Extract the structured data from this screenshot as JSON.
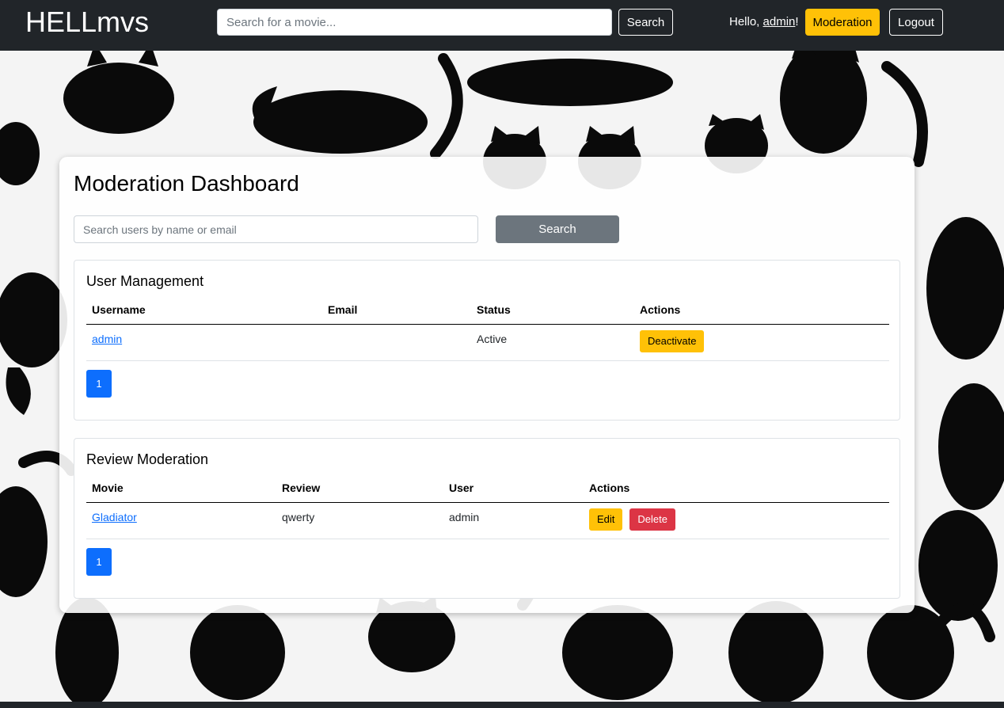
{
  "navbar": {
    "brand": "HELLmvs",
    "search_placeholder": "Search for a movie...",
    "search_label": "Search",
    "hello_prefix": "Hello, ",
    "username": "admin",
    "hello_suffix": "!",
    "moderation_label": "Moderation",
    "logout_label": "Logout"
  },
  "dashboard": {
    "title": "Moderation Dashboard",
    "search_placeholder": "Search users by name or email",
    "search_label": "Search"
  },
  "users": {
    "title": "User Management",
    "columns": [
      "Username",
      "Email",
      "Status",
      "Actions"
    ],
    "rows": [
      {
        "username": "admin",
        "email": "",
        "status": "Active",
        "action": "Deactivate"
      }
    ],
    "page": "1"
  },
  "reviews": {
    "title": "Review Moderation",
    "columns": [
      "Movie",
      "Review",
      "User",
      "Actions"
    ],
    "rows": [
      {
        "movie": "Gladiator",
        "review": "qwerty",
        "user": "admin",
        "edit": "Edit",
        "delete": "Delete"
      }
    ],
    "page": "1"
  },
  "colors": {
    "navbar": "#212529",
    "warning": "#ffc107",
    "danger": "#dc3545",
    "primary": "#0d6efd",
    "secondary": "#6c757d"
  }
}
